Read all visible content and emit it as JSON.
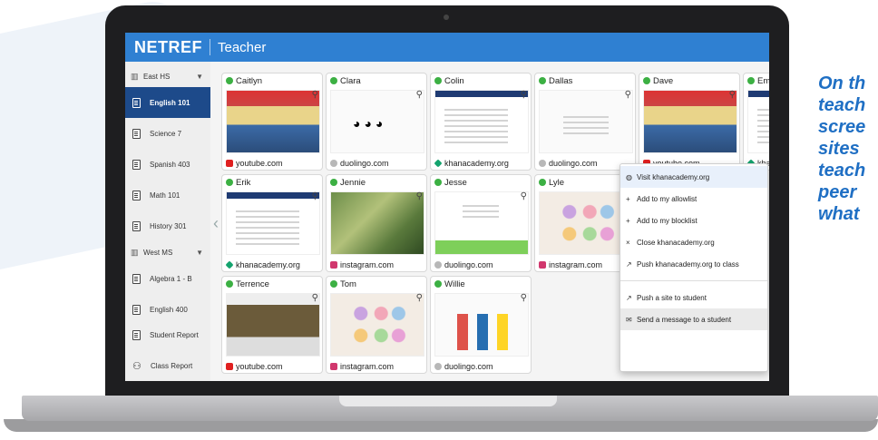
{
  "app": {
    "logo": "NETREF",
    "role": "Teacher"
  },
  "sidebar": {
    "schools": [
      {
        "name": "East HS",
        "classes": [
          "English 101",
          "Science 7",
          "Spanish 403",
          "Math 101",
          "History 301"
        ]
      },
      {
        "name": "West MS",
        "classes": [
          "Algebra 1 - B",
          "English 400"
        ]
      }
    ],
    "active_class": "English 101",
    "reports": [
      "Student Report",
      "Class Report"
    ]
  },
  "tiles": [
    {
      "name": "Caitlyn",
      "site": "youtube.com",
      "favicon": "youtube",
      "thumb": "classroom"
    },
    {
      "name": "Clara",
      "site": "duolingo.com",
      "favicon": "duolingo",
      "thumb": "duolingo-quiz"
    },
    {
      "name": "Colin",
      "site": "khanacademy.org",
      "favicon": "khan",
      "thumb": "article"
    },
    {
      "name": "Dallas",
      "site": "duolingo.com",
      "favicon": "duolingo",
      "thumb": "duolingo-quiz"
    },
    {
      "name": "Dave",
      "site": "youtube.com",
      "favicon": "youtube",
      "thumb": "classroom"
    },
    {
      "name": "Emily",
      "site": "khana",
      "favicon": "khan",
      "thumb": "article"
    },
    {
      "name": "Erik",
      "site": "khanacademy.org",
      "favicon": "khan",
      "thumb": "article"
    },
    {
      "name": "Jennie",
      "site": "instagram.com",
      "favicon": "instagram",
      "thumb": "photo"
    },
    {
      "name": "Jesse",
      "site": "duolingo.com",
      "favicon": "duolingo",
      "thumb": "quiz"
    },
    {
      "name": "Lyle",
      "site": "instagram.com",
      "favicon": "instagram",
      "thumb": "cats"
    },
    {
      "name": "Terrence",
      "site": "youtube.com",
      "favicon": "youtube",
      "thumb": "video"
    },
    {
      "name": "Tom",
      "site": "instagram.com",
      "favicon": "instagram",
      "thumb": "cats"
    },
    {
      "name": "Willie",
      "site": "duolingo.com",
      "favicon": "duolingo",
      "thumb": "flags"
    }
  ],
  "context_menu": {
    "group1": [
      {
        "icon": "globe-icon",
        "label": "Visit khanacademy.org"
      },
      {
        "icon": "plus-icon",
        "label": "Add to my allowlist"
      },
      {
        "icon": "plus-icon",
        "label": "Add to my blocklist"
      },
      {
        "icon": "close-icon",
        "label": "Close khanacademy.org"
      },
      {
        "icon": "external-icon",
        "label": "Push khanacademy.org to class"
      }
    ],
    "group2": [
      {
        "icon": "external-icon",
        "label": "Push a site to student"
      },
      {
        "icon": "message-icon",
        "label": "Send a message to a student"
      }
    ]
  },
  "caption": {
    "lines": [
      "On th",
      "teach",
      "scree",
      "sites",
      "teach",
      "peer",
      "what"
    ]
  },
  "colors": {
    "topbar": "#2f80d2",
    "active_class": "#1d4a8a",
    "online": "#3cb043",
    "caption": "#1f6fc4"
  }
}
